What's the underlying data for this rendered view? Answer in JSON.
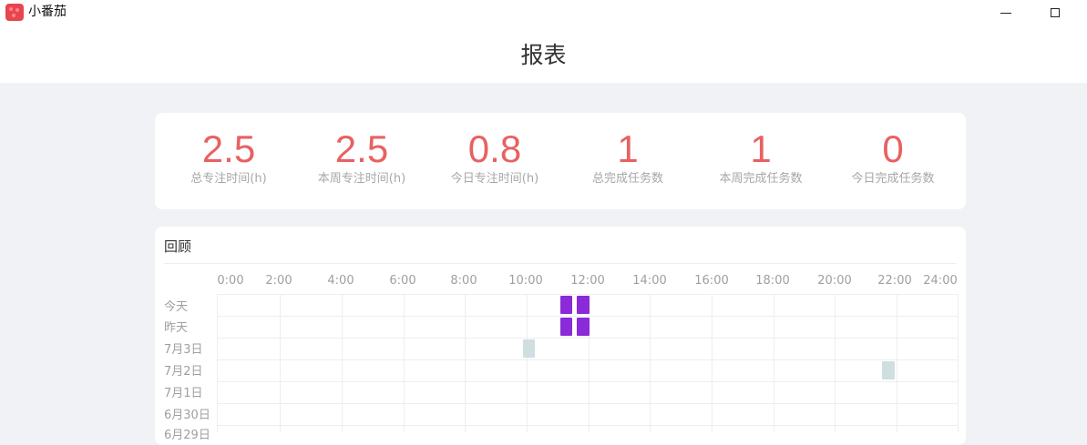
{
  "window": {
    "app_name": "小番茄",
    "minimize_icon": "minimize-icon",
    "maximize_icon": "maximize-icon"
  },
  "header": {
    "title": "报表"
  },
  "stats": [
    {
      "value": "2.5",
      "label": "总专注时间(h)"
    },
    {
      "value": "2.5",
      "label": "本周专注时间(h)"
    },
    {
      "value": "0.8",
      "label": "今日专注时间(h)"
    },
    {
      "value": "1",
      "label": "总完成任务数"
    },
    {
      "value": "1",
      "label": "本周完成任务数"
    },
    {
      "value": "0",
      "label": "今日完成任务数"
    }
  ],
  "review": {
    "title": "回顾",
    "hour_ticks": [
      "0:00",
      "2:00",
      "4:00",
      "6:00",
      "8:00",
      "10:00",
      "12:00",
      "14:00",
      "16:00",
      "18:00",
      "20:00",
      "22:00",
      "24:00"
    ],
    "days": [
      "今天",
      "昨天",
      "7月3日",
      "7月2日",
      "7月1日",
      "6月30日",
      "6月29日"
    ],
    "sessions": [
      {
        "day": 0,
        "start": 11.1,
        "end": 11.5,
        "color": "#8b2ad8"
      },
      {
        "day": 0,
        "start": 11.65,
        "end": 12.05,
        "color": "#8b2ad8"
      },
      {
        "day": 1,
        "start": 11.1,
        "end": 11.5,
        "color": "#8b2ad8"
      },
      {
        "day": 1,
        "start": 11.65,
        "end": 12.05,
        "color": "#8b2ad8"
      },
      {
        "day": 2,
        "start": 9.9,
        "end": 10.3,
        "color": "#cfdee0"
      },
      {
        "day": 3,
        "start": 21.55,
        "end": 21.95,
        "color": "#cfdee0"
      }
    ]
  },
  "colors": {
    "accent": "#e86161",
    "session_focus": "#8b2ad8",
    "session_past": "#cfdee0"
  }
}
